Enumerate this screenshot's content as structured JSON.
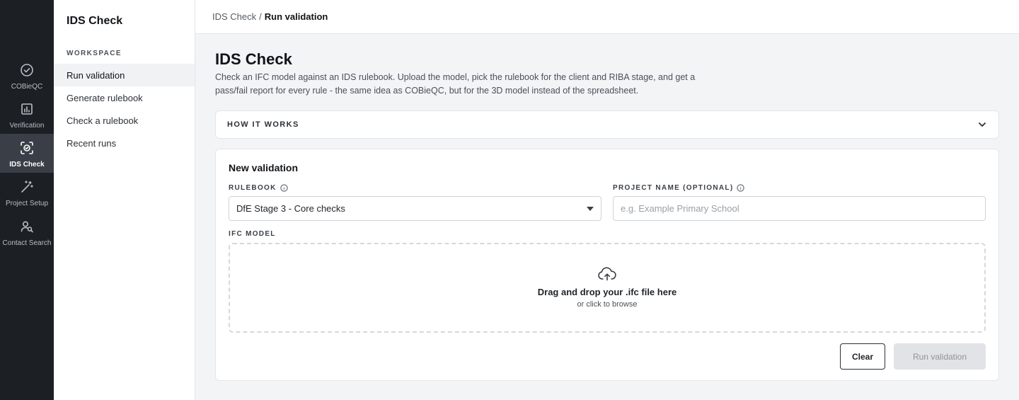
{
  "rail": {
    "items": [
      {
        "label": "COBieQC",
        "icon": "check-circle-icon",
        "active": false
      },
      {
        "label": "Verification",
        "icon": "bar-chart-icon",
        "active": false
      },
      {
        "label": "IDS Check",
        "icon": "ids-scan-icon",
        "active": true
      },
      {
        "label": "Project Setup",
        "icon": "magic-wand-icon",
        "active": false
      },
      {
        "label": "Contact Search",
        "icon": "user-search-icon",
        "active": false
      }
    ]
  },
  "sidebar": {
    "title": "IDS Check",
    "section_label": "WORKSPACE",
    "items": [
      {
        "label": "Run validation",
        "active": true
      },
      {
        "label": "Generate rulebook",
        "active": false
      },
      {
        "label": "Check a rulebook",
        "active": false
      },
      {
        "label": "Recent runs",
        "active": false
      }
    ]
  },
  "breadcrumb": {
    "root": "IDS Check",
    "separator": "/",
    "current": "Run validation"
  },
  "main": {
    "title": "IDS Check",
    "description": "Check an IFC model against an IDS rulebook. Upload the model, pick the rulebook for the client and RIBA stage, and get a pass/fail report for every rule - the same idea as COBieQC, but for the 3D model instead of the spreadsheet.",
    "accordion": {
      "title": "HOW IT WORKS",
      "icon": "chevron-down-icon",
      "expanded": false
    }
  },
  "form": {
    "title": "New validation",
    "rulebook_label": "RULEBOOK",
    "rulebook_value": "DfE Stage 3 - Core checks",
    "project_label": "PROJECT NAME (OPTIONAL)",
    "project_value": "",
    "project_placeholder": "e.g. Example Primary School",
    "ifc_label": "IFC MODEL",
    "drop_main": "Drag and drop your .ifc file here",
    "drop_sub": "or click to browse",
    "clear_label": "Clear",
    "run_label": "Run validation",
    "run_disabled": true
  }
}
